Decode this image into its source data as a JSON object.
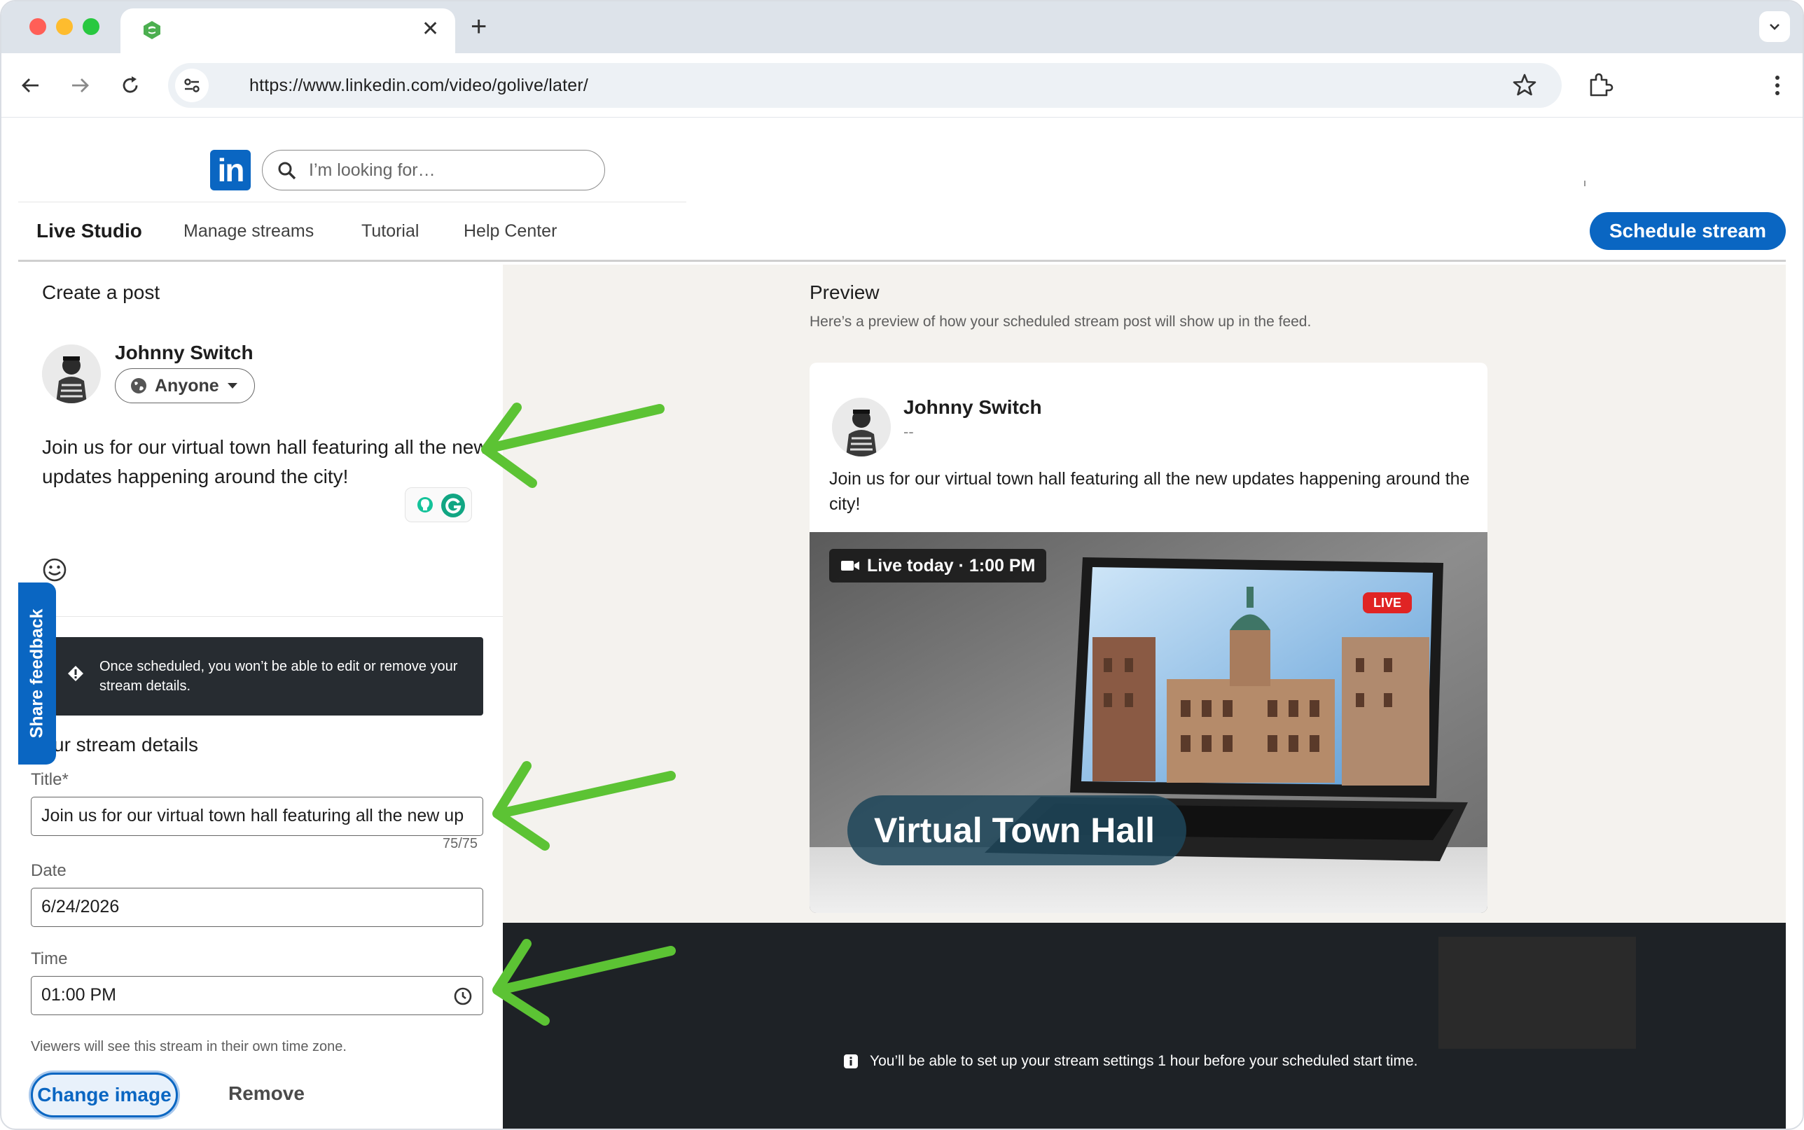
{
  "browser": {
    "url": "https://www.linkedin.com/video/golive/later/",
    "tab_close": "✕",
    "new_tab": "+"
  },
  "header": {
    "logo_text": "in",
    "search_placeholder": "I’m looking for…"
  },
  "subnav": {
    "items": [
      "Live Studio",
      "Manage streams",
      "Tutorial",
      "Help Center"
    ],
    "schedule_button": "Schedule stream"
  },
  "create_post": {
    "heading": "Create a post",
    "author": "Johnny Switch",
    "visibility": "Anyone",
    "body": "Join us for our virtual town hall featuring all the new updates happening around the city!",
    "notice": "Once scheduled, you won’t be able to edit or remove your stream details.",
    "stream_details_heading": "ur stream details",
    "title_label": "Title*",
    "title_value": "Join us for our virtual town hall featuring all the new up",
    "title_counter": "75/75",
    "date_label": "Date",
    "date_value": "6/24/2026",
    "time_label": "Time",
    "time_value": "01:00 PM",
    "timezone_note": "Viewers will see this stream in their own time zone.",
    "change_image": "Change image",
    "remove": "Remove",
    "share_feedback": "Share feedback"
  },
  "preview": {
    "heading": "Preview",
    "subheading": "Here’s a preview of how your scheduled stream post will show up in the feed.",
    "author": "Johnny Switch",
    "meta": "--",
    "body": "Join us for our virtual town hall featuring all the new updates happening around the city!",
    "live_tag": "Live today · 1:00 PM",
    "live_badge": "LIVE",
    "thumbnail_title": "Virtual Town Hall"
  },
  "footer_note": "You’ll be able to set up your stream settings 1 hour before your scheduled start time.",
  "colors": {
    "linkedin_blue": "#0a66c2",
    "annotation_green": "#5cc334",
    "dark_panel": "#1e2226"
  }
}
